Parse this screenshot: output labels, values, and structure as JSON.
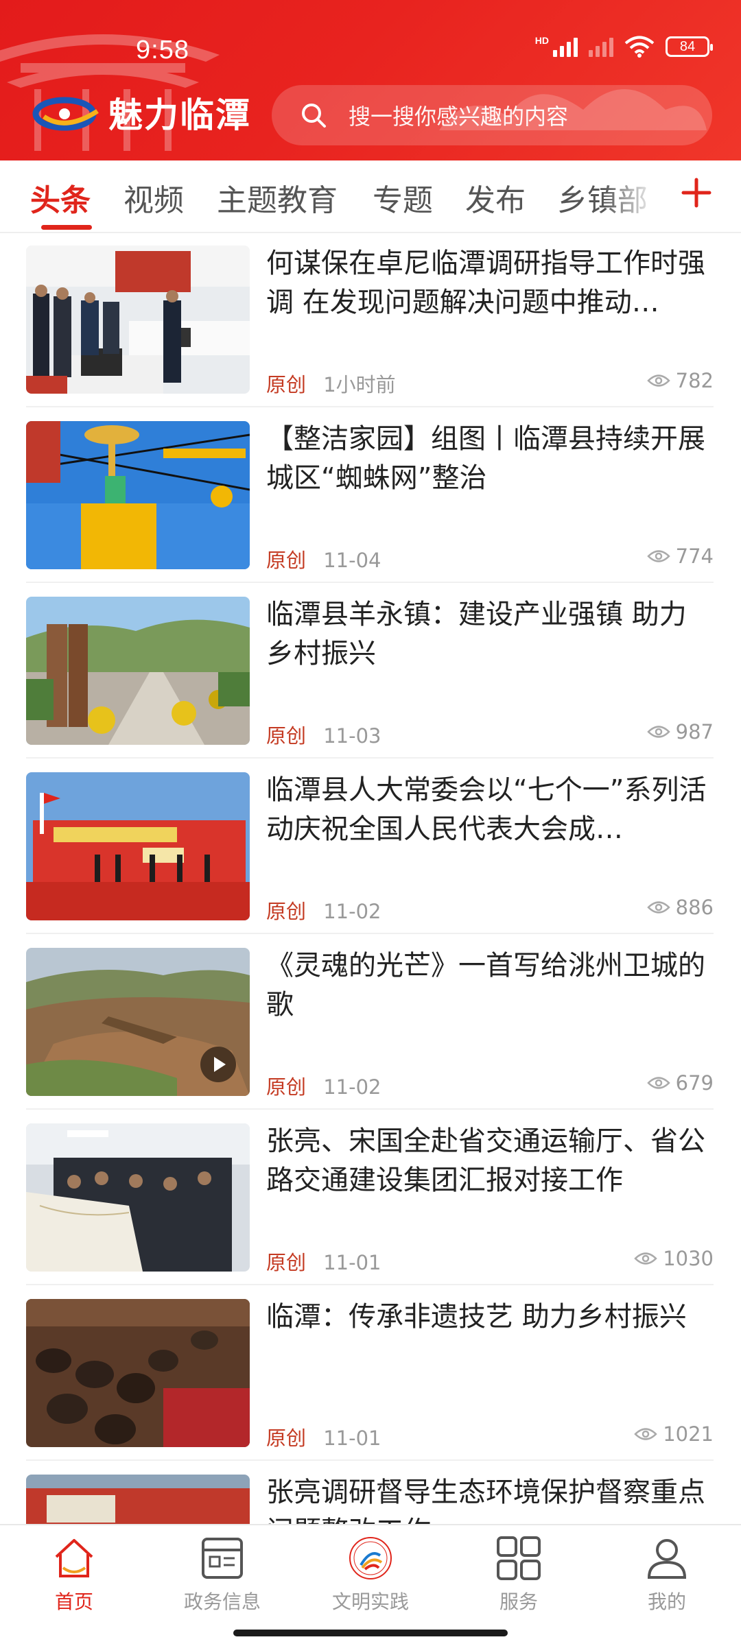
{
  "status_bar": {
    "time": "9:58",
    "battery": "84",
    "network_label": "HD"
  },
  "header": {
    "logo_text": "魅力临潭",
    "search_placeholder": "搜一搜你感兴趣的内容"
  },
  "tabs": [
    "头条",
    "视频",
    "主题教育",
    "专题",
    "发布",
    "乡镇部"
  ],
  "active_tab": "头条",
  "news": [
    {
      "title": "何谋保在卓尼临潭调研指导工作时强调 在发现问题解决问题中推动…",
      "tag": "原创",
      "date": "1小时前",
      "views": "782",
      "thumb": "meeting-office"
    },
    {
      "title": "【整洁家园】组图丨临潭县持续开展城区“蜘蛛网”整治",
      "tag": "原创",
      "date": "11-04",
      "views": "774",
      "thumb": "bucket-truck"
    },
    {
      "title": "临潭县羊永镇：建设产业强镇 助力乡村振兴",
      "tag": "原创",
      "date": "11-03",
      "views": "987",
      "thumb": "town-square"
    },
    {
      "title": "临潭县人大常委会以“七个一”系列活动庆祝全国人民代表大会成…",
      "tag": "原创",
      "date": "11-02",
      "views": "886",
      "thumb": "stage-ceremony"
    },
    {
      "title": "《灵魂的光芒》一首写给洮州卫城的歌",
      "tag": "原创",
      "date": "11-02",
      "views": "679",
      "thumb": "mountain-aerial",
      "video": true
    },
    {
      "title": "张亮、宋国全赴省交通运输厅、省公路交通建设集团汇报对接工作",
      "tag": "原创",
      "date": "11-01",
      "views": "1030",
      "thumb": "map-review"
    },
    {
      "title": "临潭：传承非遗技艺 助力乡村振兴",
      "tag": "原创",
      "date": "11-01",
      "views": "1021",
      "thumb": "craft-pots"
    },
    {
      "title": "张亮调研督导生态环境保护督察重点问题整改工作",
      "tag": "",
      "date": "",
      "views": "",
      "thumb": "street"
    }
  ],
  "bottom_nav": [
    {
      "label": "首页",
      "icon": "home-icon",
      "active": true
    },
    {
      "label": "政务信息",
      "icon": "document-icon",
      "active": false
    },
    {
      "label": "文明实践",
      "icon": "emblem-icon",
      "active": false
    },
    {
      "label": "服务",
      "icon": "grid-icon",
      "active": false
    },
    {
      "label": "我的",
      "icon": "user-icon",
      "active": false
    }
  ],
  "colors": {
    "brand_red": "#e0251b",
    "header_red": "#e8231f",
    "tag_red": "#c43a22"
  }
}
